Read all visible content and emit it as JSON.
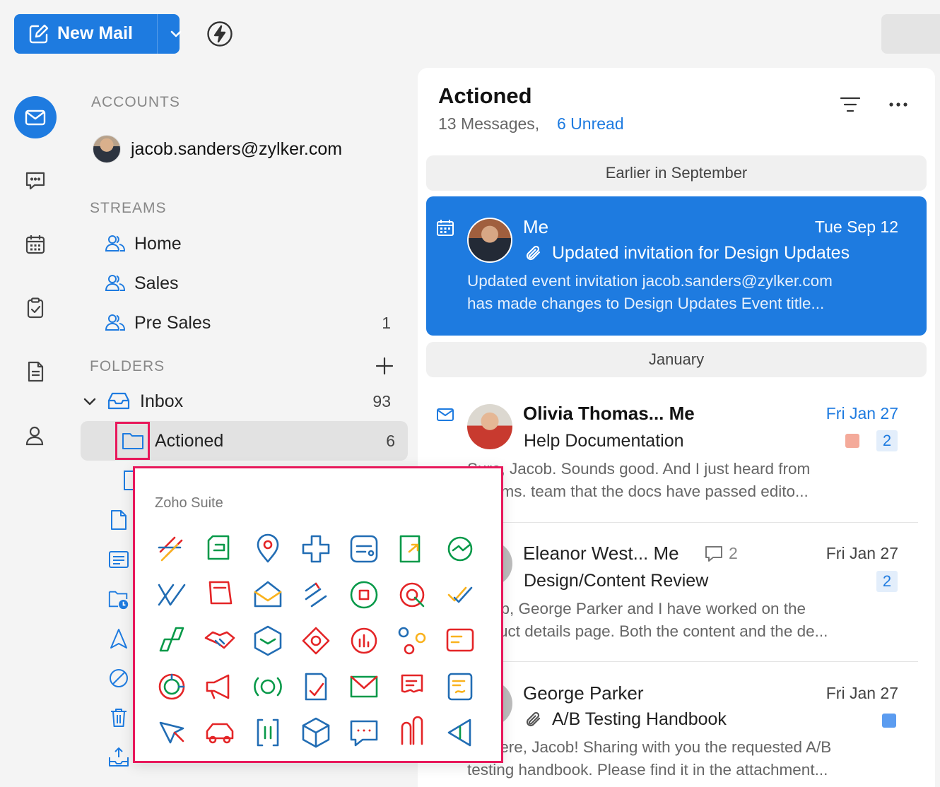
{
  "toolbar": {
    "new_mail_label": "New Mail"
  },
  "sidebar": {
    "accounts_label": "ACCOUNTS",
    "account_email": "jacob.sanders@zylker.com",
    "streams_label": "STREAMS",
    "streams": [
      {
        "label": "Home",
        "count": ""
      },
      {
        "label": "Sales",
        "count": ""
      },
      {
        "label": "Pre Sales",
        "count": "1"
      }
    ],
    "folders_label": "FOLDERS",
    "inbox": {
      "label": "Inbox",
      "count": "93"
    },
    "actioned": {
      "label": "Actioned",
      "count": "6"
    }
  },
  "popup": {
    "title": "Zoho Suite",
    "apps": [
      "zoho-projects-icon",
      "zoho-analytics-icon",
      "zoho-assist-icon",
      "zoho-creator-icon",
      "zoho-invoice-icon",
      "zoho-sheet-icon",
      "zoho-sync-icon",
      "zoho-desk-icon",
      "zoho-notebook-icon",
      "zoho-mail-icon",
      "zoho-flow-icon",
      "zoho-cliq-icon",
      "zoho-campaigns-icon",
      "zoho-checkout-icon",
      "zoho-bookings-icon",
      "zoho-partners-icon",
      "zoho-workdrive-icon",
      "zoho-vault-icon",
      "zoho-survey-icon",
      "zoho-connect-icon",
      "zoho-forms-icon",
      "zoho-crm-icon",
      "zoho-social-icon",
      "zoho-meeting-icon",
      "zoho-recruit-icon",
      "zoho-campaigns-mail-icon",
      "zoho-writer-icon",
      "zoho-sign-icon",
      "zoho-sites-icon",
      "zoho-fleet-icon",
      "zoho-bigin-icon",
      "zoho-commerce-icon",
      "zoho-chat-icon",
      "zoho-showtime-icon",
      "zoho-show-icon"
    ]
  },
  "list": {
    "title": "Actioned",
    "messages_text": "13 Messages,",
    "unread_text": "6 Unread",
    "groups": [
      "Earlier in September",
      "January"
    ],
    "mails": [
      {
        "from": "Me",
        "date": "Tue Sep 12",
        "subject": "Updated invitation for  Design Updates",
        "preview1": "Updated event invitation jacob.sanders@zylker.com",
        "preview2": "has made changes to Design Updates Event title..."
      },
      {
        "from": "Olivia Thomas... Me",
        "date": "Fri Jan 27",
        "subject": "Help Documentation",
        "badge": "2",
        "preview1": "Sure, Jacob. Sounds good. And I just heard from",
        "preview2": "Comms. team that the docs have passed edito..."
      },
      {
        "from": "Eleanor West... Me",
        "thread_count": "2",
        "date": "Fri Jan 27",
        "subject": "Design/Content Review",
        "badge": "2",
        "preview1": "Jacob, George Parker and I have worked on the",
        "preview2": "product details page. Both the content and the de..."
      },
      {
        "from": "George Parker",
        "date": "Fri Jan 27",
        "subject": "A/B Testing Handbook",
        "preview1": "Hi there, Jacob! Sharing with you the requested A/B",
        "preview2": "testing handbook. Please find it in the attachment..."
      }
    ]
  },
  "colors": {
    "accent": "#1e7be0",
    "highlight": "#e8185b",
    "tag_salmon": "#f4aa9a",
    "tag_blue": "#5b9cf0"
  }
}
